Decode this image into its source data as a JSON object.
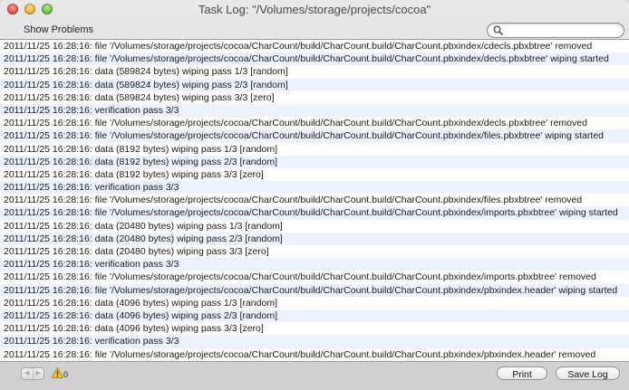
{
  "window": {
    "title": "Task Log: \"/Volumes/storage/projects/cocoa\""
  },
  "toolbar": {
    "show_problems_label": "Show Problems",
    "search_value": "",
    "search_placeholder": ""
  },
  "log": {
    "rows": [
      "2011/11/25 16:28:16: file '/Volumes/storage/projects/cocoa/CharCount/build/CharCount.build/CharCount.pbxindex/cdecls.pbxbtree' removed",
      "2011/11/25 16:28:16: file '/Volumes/storage/projects/cocoa/CharCount/build/CharCount.build/CharCount.pbxindex/decls.pbxbtree' wiping started",
      "2011/11/25 16:28:16: data  (589824 bytes) wiping pass 1/3 [random]",
      "2011/11/25 16:28:16: data  (589824 bytes) wiping pass 2/3 [random]",
      "2011/11/25 16:28:16: data  (589824 bytes) wiping pass 3/3 [zero]",
      "2011/11/25 16:28:16: verification pass 3/3",
      "2011/11/25 16:28:16: file '/Volumes/storage/projects/cocoa/CharCount/build/CharCount.build/CharCount.pbxindex/decls.pbxbtree' removed",
      "2011/11/25 16:28:16: file '/Volumes/storage/projects/cocoa/CharCount/build/CharCount.build/CharCount.pbxindex/files.pbxbtree' wiping started",
      "2011/11/25 16:28:16: data  (8192 bytes) wiping pass 1/3 [random]",
      "2011/11/25 16:28:16: data  (8192 bytes) wiping pass 2/3 [random]",
      "2011/11/25 16:28:16: data  (8192 bytes) wiping pass 3/3 [zero]",
      "2011/11/25 16:28:16: verification pass 3/3",
      "2011/11/25 16:28:16: file '/Volumes/storage/projects/cocoa/CharCount/build/CharCount.build/CharCount.pbxindex/files.pbxbtree' removed",
      "2011/11/25 16:28:16: file '/Volumes/storage/projects/cocoa/CharCount/build/CharCount.build/CharCount.pbxindex/imports.pbxbtree' wiping started",
      "2011/11/25 16:28:16: data  (20480 bytes) wiping pass 1/3 [random]",
      "2011/11/25 16:28:16: data  (20480 bytes) wiping pass 2/3 [random]",
      "2011/11/25 16:28:16: data  (20480 bytes) wiping pass 3/3 [zero]",
      "2011/11/25 16:28:16: verification pass 3/3",
      "2011/11/25 16:28:16: file '/Volumes/storage/projects/cocoa/CharCount/build/CharCount.build/CharCount.pbxindex/imports.pbxbtree' removed",
      "2011/11/25 16:28:16: file '/Volumes/storage/projects/cocoa/CharCount/build/CharCount.build/CharCount.pbxindex/pbxindex.header' wiping started",
      "2011/11/25 16:28:16: data  (4096 bytes) wiping pass 1/3 [random]",
      "2011/11/25 16:28:16: data  (4096 bytes) wiping pass 2/3 [random]",
      "2011/11/25 16:28:16: data  (4096 bytes) wiping pass 3/3 [zero]",
      "2011/11/25 16:28:16: verification pass 3/3",
      "2011/11/25 16:28:16: file '/Volumes/storage/projects/cocoa/CharCount/build/CharCount.build/CharCount.pbxindex/pbxindex.header' removed"
    ]
  },
  "bottombar": {
    "warning_count": "0",
    "print_label": "Print",
    "save_log_label": "Save Log"
  },
  "icons": {
    "search": "search-icon",
    "warning": "warning-icon",
    "back": "back-arrow-icon",
    "forward": "forward-arrow-icon"
  },
  "colors": {
    "row_alt": "#edf3fe",
    "close": "#e0443a",
    "minimize": "#e5a323",
    "zoom": "#5cb534"
  }
}
